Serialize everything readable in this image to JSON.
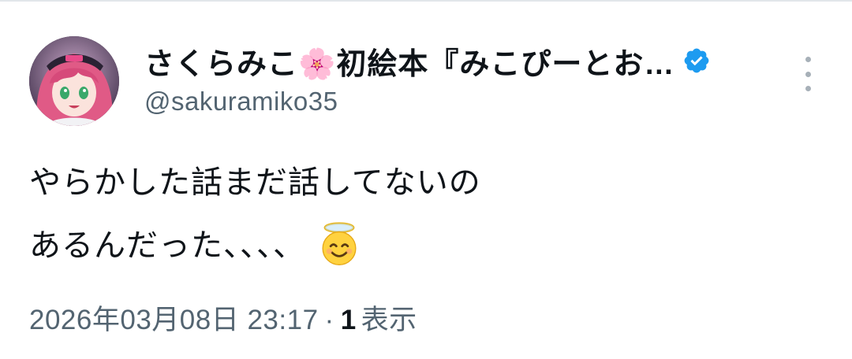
{
  "tweet": {
    "display_name": "さくらみこ🌸初絵本『みこぴーとお…",
    "handle": "@sakuramiko35",
    "verified": true,
    "text_lines": [
      "やらかした話まだ話してないの",
      "あるんだった、、、、"
    ],
    "trailing_emoji": "halo-smile-emoji",
    "timestamp": "2026年03月08日 23:17",
    "separator": "·",
    "views_count": "1",
    "views_label": "表示"
  },
  "colors": {
    "text_primary": "#0f1419",
    "text_secondary": "#536471",
    "verified_blue": "#1d9bf0",
    "divider": "#e2e6ea"
  },
  "icons": {
    "verified": "verified-badge-icon",
    "more": "more-options-icon"
  }
}
